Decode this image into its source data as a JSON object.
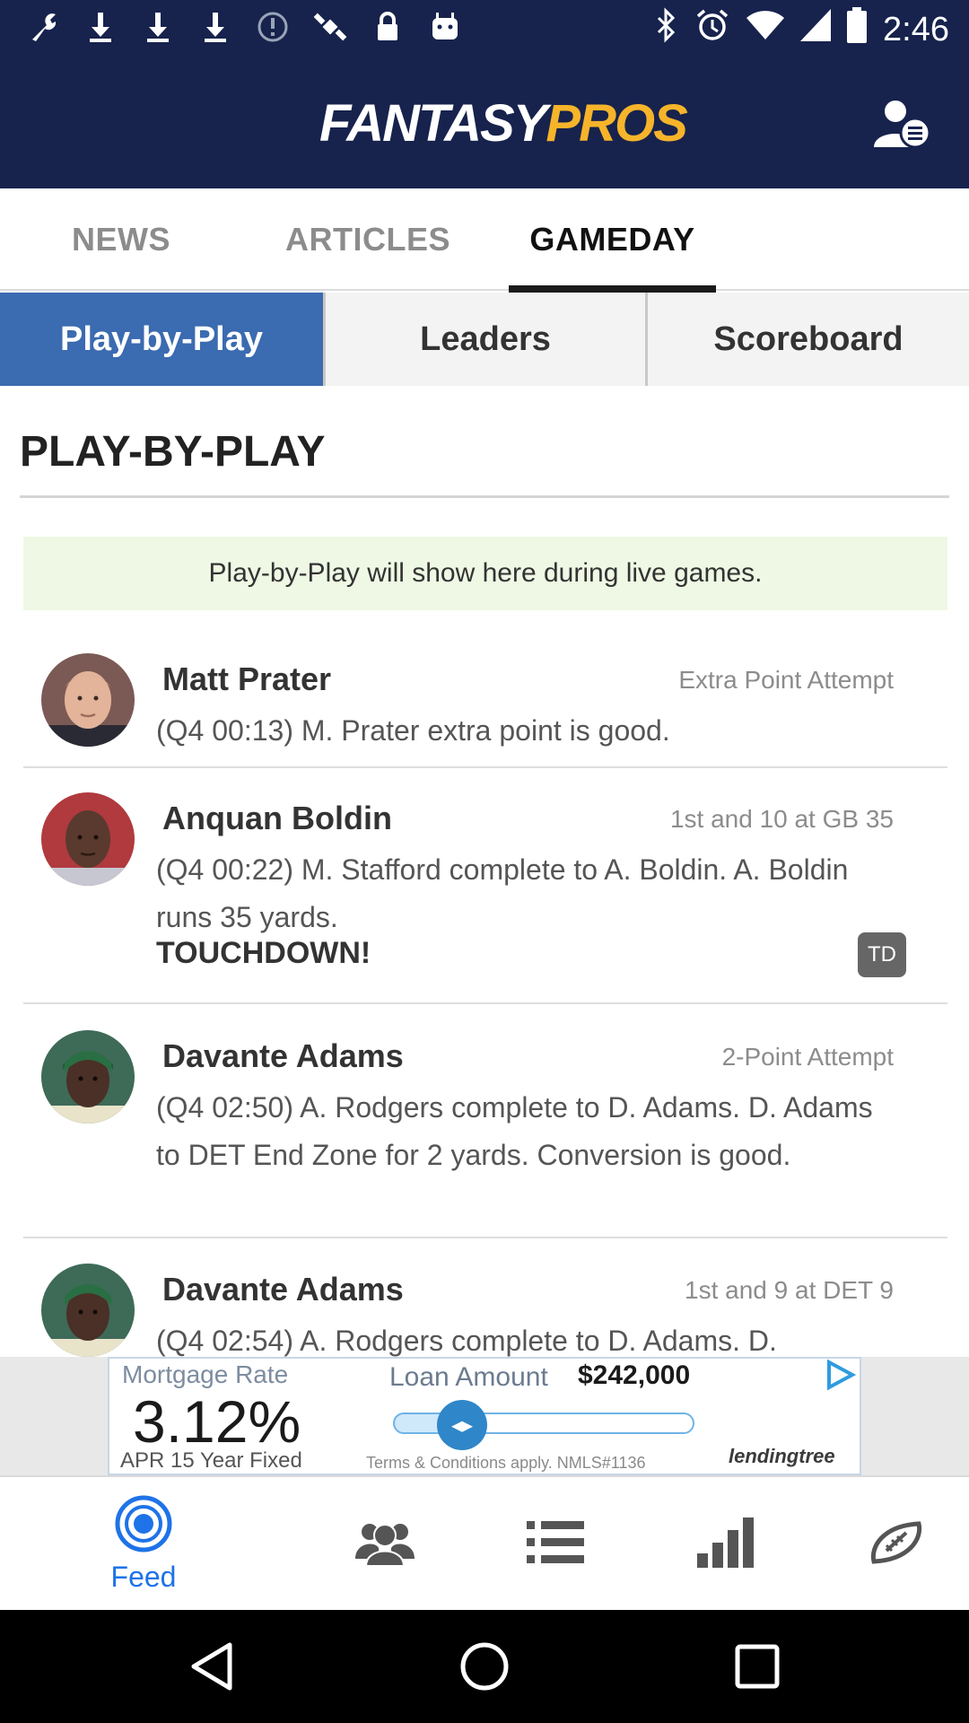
{
  "status_bar": {
    "time": "2:46",
    "left_icons": [
      "wrench-icon",
      "download-icon",
      "download-icon",
      "download-icon",
      "alert-circle-icon",
      "satellite-icon",
      "lock-icon",
      "android-icon"
    ],
    "right_icons": [
      "bluetooth-icon",
      "alarm-icon",
      "wifi-icon",
      "signal-icon",
      "battery-icon"
    ]
  },
  "app": {
    "logo_part1": "FANTASY",
    "logo_part2": "PROS",
    "logo_colors": {
      "fantasy": "#ffffff",
      "pros": "#f6b42a"
    },
    "header_color": "#17234d",
    "account_icon": "account-settings-icon"
  },
  "top_tabs": [
    {
      "label": "NEWS",
      "active": false
    },
    {
      "label": "ARTICLES",
      "active": false
    },
    {
      "label": "GAMEDAY",
      "active": true
    }
  ],
  "sub_tabs": [
    {
      "label": "Play-by-Play",
      "active": true
    },
    {
      "label": "Leaders",
      "active": false
    },
    {
      "label": "Scoreboard",
      "active": false
    }
  ],
  "accent_color": "#3b6bb0",
  "section": {
    "title": "PLAY-BY-PLAY",
    "info_banner": "Play-by-Play will show here during live games."
  },
  "plays": [
    {
      "player": "Matt Prater",
      "event": "Extra Point Attempt",
      "description": "(Q4 00:13) M. Prater extra point is good."
    },
    {
      "player": "Anquan Boldin",
      "event": "1st and 10 at GB 35",
      "description": "(Q4 00:22) M. Stafford complete to A. Boldin. A. Boldin runs 35 yards.",
      "highlight": "TOUCHDOWN!",
      "badge": "TD"
    },
    {
      "player": "Davante Adams",
      "event": "2-Point Attempt",
      "description": "(Q4 02:50) A. Rodgers complete to D. Adams. D. Adams to DET End Zone for 2 yards. Conversion is good."
    },
    {
      "player": "Davante Adams",
      "event": "1st and 9 at DET 9",
      "description": "(Q4 02:54) A. Rodgers complete to D. Adams. D."
    }
  ],
  "ad": {
    "mortgage_label": "Mortgage Rate",
    "rate": "3.12%",
    "apr_label": "APR 15 Year Fixed",
    "loan_label": "Loan Amount",
    "loan_amount": "$242,000",
    "terms": "Terms & Conditions apply. NMLS#1136",
    "lender": "lendingtree"
  },
  "bottom_nav": [
    {
      "label": "Feed",
      "icon": "feed-icon",
      "active": true
    },
    {
      "label": "",
      "icon": "players-icon",
      "active": false
    },
    {
      "label": "",
      "icon": "list-icon",
      "active": false
    },
    {
      "label": "",
      "icon": "rankings-icon",
      "active": false
    },
    {
      "label": "",
      "icon": "football-icon",
      "active": false
    }
  ],
  "system_nav": [
    "back-icon",
    "home-icon",
    "recents-icon"
  ]
}
